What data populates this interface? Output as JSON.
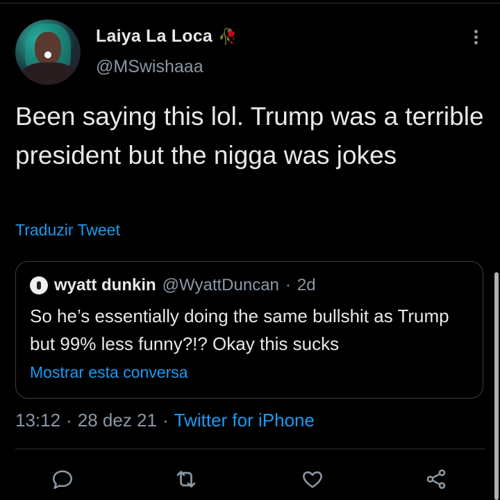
{
  "author": {
    "name": "Laiya La Loca",
    "handle": "@MSwishaaa",
    "badge_emoji": "🥀"
  },
  "tweet": {
    "text": "Been saying this lol. Trump was a terrible president but the nigga was jokes",
    "translate_label": "Traduzir Tweet"
  },
  "quote": {
    "name": "wyatt dunkin",
    "handle": "@WyattDuncan",
    "separator": "·",
    "age": "2d",
    "text": "So he’s essentially doing the same bullshit as Trump but 99% less funny?!? Okay this sucks",
    "show_conversation": "Mostrar esta conversa"
  },
  "meta": {
    "time": "13:12",
    "sep1": "·",
    "date": "28 dez 21",
    "sep2": "·",
    "source": "Twitter for iPhone"
  },
  "actions": [
    {
      "icon": "reply-icon"
    },
    {
      "icon": "retweet-icon"
    },
    {
      "icon": "like-icon"
    },
    {
      "icon": "share-icon"
    }
  ],
  "colors": {
    "background": "#000000",
    "text": "#e7e9ea",
    "muted": "#8b98a5",
    "link": "#1d9bf0",
    "border": "#2f3336"
  }
}
